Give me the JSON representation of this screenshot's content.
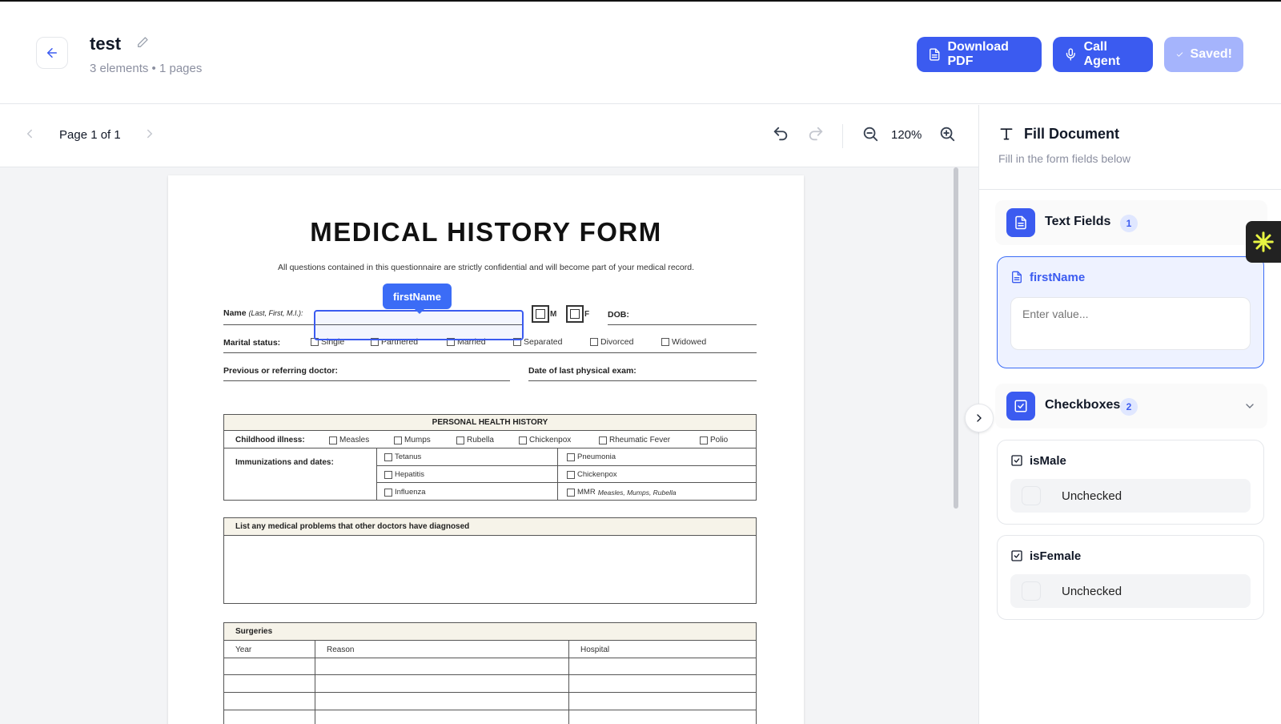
{
  "header": {
    "title": "test",
    "subtitle": "3 elements • 1 pages",
    "download_label": "Download PDF",
    "call_label": "Call Agent",
    "saved_label": "Saved!"
  },
  "toolbar": {
    "page_label": "Page 1 of 1",
    "zoom": "120%"
  },
  "document": {
    "title": "MEDICAL HISTORY FORM",
    "note": "All questions contained in this questionnaire are strictly confidential and will become part of your medical record.",
    "name_label": "Name",
    "name_hint": "(Last, First, M.I.):",
    "m_letter": "M",
    "f_letter": "F",
    "dob_label": "DOB:",
    "marital_label": "Marital status:",
    "marital_options": [
      "Single",
      "Partnered",
      "Married",
      "Separated",
      "Divorced",
      "Widowed"
    ],
    "doctor_label": "Previous or referring doctor:",
    "exam_label": "Date of last physical exam:",
    "phh_title": "PERSONAL HEALTH HISTORY",
    "childhood_label": "Childhood illness:",
    "childhood_options": [
      "Measles",
      "Mumps",
      "Rubella",
      "Chickenpox",
      "Rheumatic Fever",
      "Polio"
    ],
    "immun_label": "Immunizations and dates:",
    "immun_left": [
      "Tetanus",
      "Hepatitis",
      "Influenza"
    ],
    "immun_right": [
      "Pneumonia",
      "Chickenpox",
      "MMR"
    ],
    "mmr_hint": "Measles, Mumps, Rubella",
    "problems_title": "List any medical problems that other doctors have diagnosed",
    "surgeries_title": "Surgeries",
    "surgery_cols": [
      "Year",
      "Reason",
      "Hospital"
    ],
    "field_tag": "firstName"
  },
  "panel": {
    "title": "Fill Document",
    "subtitle": "Fill in the form fields below",
    "text_section": {
      "title": "Text Fields",
      "count": "1"
    },
    "checkbox_section": {
      "title": "Checkboxes",
      "count": "2"
    },
    "first_name": {
      "label": "firstName",
      "placeholder": "Enter value..."
    },
    "is_male": {
      "label": "isMale",
      "state": "Unchecked"
    },
    "is_female": {
      "label": "isFemale",
      "state": "Unchecked"
    }
  },
  "colors": {
    "accent": "#3b5bf0",
    "saved": "#a5b4fc",
    "badge_bg": "#e0e7ff"
  },
  "icons": [
    "arrow-left-icon",
    "pencil-icon",
    "document-icon",
    "microphone-icon",
    "check-icon",
    "chevron-left-icon",
    "chevron-right-icon",
    "undo-icon",
    "redo-icon",
    "zoom-out-icon",
    "zoom-in-icon",
    "text-icon",
    "checkbox-icon",
    "chevron-down-icon",
    "asterisk-icon"
  ]
}
